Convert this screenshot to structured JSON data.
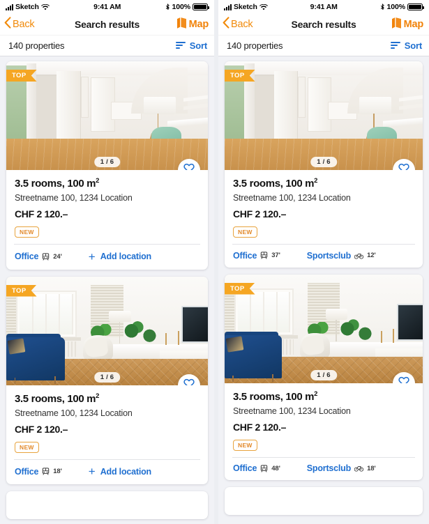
{
  "colors": {
    "accent_orange": "#f1830a",
    "badge_orange": "#f5a623",
    "link_blue": "#1f6fd0",
    "new_border": "#e8a33d",
    "page_bg": "#eceef2"
  },
  "status_bar": {
    "carrier": "Sketch",
    "time": "9:41 AM",
    "battery_percent": "100%",
    "wifi_icon": "wifi-icon",
    "bluetooth_icon": "bluetooth-icon",
    "signal_icon": "signal-bars-icon",
    "battery_icon": "battery-icon"
  },
  "nav_bar": {
    "back_label": "Back",
    "back_icon": "chevron-left-icon",
    "title": "Search results",
    "map_label": "Map",
    "map_icon": "map-icon"
  },
  "results_bar": {
    "count_label": "140 properties",
    "sort_label": "Sort",
    "sort_icon": "sort-lines-icon"
  },
  "panels": [
    {
      "id": "left",
      "cards": [
        {
          "badge": "TOP",
          "photo": "A",
          "counter": "1 / 6",
          "favorite_icon": "heart-outline-icon",
          "title": "3.5 rooms, 100 m",
          "title_sup": "2",
          "address": "Streetname 100, 1234 Location",
          "price": "CHF 2 120.–",
          "tag": "NEW",
          "poi_primary": {
            "name": "Office",
            "icon": "tram-icon",
            "minutes": "24'"
          },
          "action": {
            "type": "add",
            "icon": "plus-icon",
            "label": "Add location"
          }
        },
        {
          "badge": "TOP",
          "photo": "B",
          "counter": "1 / 6",
          "favorite_icon": "heart-outline-icon",
          "title": "3.5 rooms, 100 m",
          "title_sup": "2",
          "address": "Streetname 100, 1234 Location",
          "price": "CHF 2 120.–",
          "tag": "NEW",
          "poi_primary": {
            "name": "Office",
            "icon": "tram-icon",
            "minutes": "18'"
          },
          "action": {
            "type": "add",
            "icon": "plus-icon",
            "label": "Add location"
          }
        }
      ]
    },
    {
      "id": "right",
      "cards": [
        {
          "badge": "TOP",
          "photo": "A",
          "counter": "1 / 6",
          "favorite_icon": "heart-outline-icon",
          "title": "3.5 rooms, 100 m",
          "title_sup": "2",
          "address": "Streetname 100, 1234 Location",
          "price": "CHF 2 120.–",
          "tag": "NEW",
          "poi_primary": {
            "name": "Office",
            "icon": "tram-icon",
            "minutes": "37'"
          },
          "action": {
            "type": "poi",
            "name": "Sportsclub",
            "icon": "bike-icon",
            "minutes": "12'"
          }
        },
        {
          "badge": "TOP",
          "photo": "B",
          "counter": "1 / 6",
          "favorite_icon": "heart-outline-icon",
          "title": "3.5 rooms, 100 m",
          "title_sup": "2",
          "address": "Streetname 100, 1234 Location",
          "price": "CHF 2 120.–",
          "tag": "NEW",
          "poi_primary": {
            "name": "Office",
            "icon": "tram-icon",
            "minutes": "48'"
          },
          "action": {
            "type": "poi",
            "name": "Sportsclub",
            "icon": "bike-icon",
            "minutes": "18'"
          }
        }
      ]
    }
  ]
}
